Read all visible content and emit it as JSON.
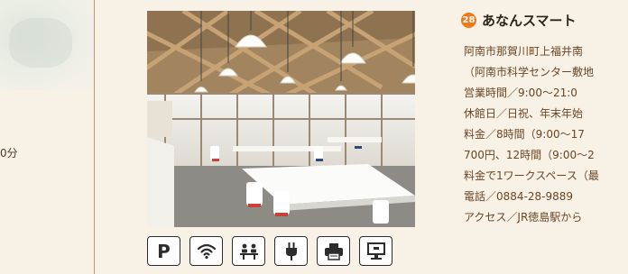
{
  "left": {
    "fragment_text": "0分"
  },
  "listing": {
    "number": "28",
    "title": "あなんスマート",
    "details": [
      "阿南市那賀川町上福井南",
      "（阿南市科学センター敷地",
      "営業時間／9:00〜21:0",
      "休館日／日祝、年末年始",
      "料金／8時間（9:00〜17",
      "700円、12時間（9:00〜2",
      "料金で1ワークスペース（最",
      "電話／0884-28-9889",
      "アクセス／JR徳島駅から"
    ]
  },
  "amenity_icons": [
    "parking-icon",
    "wifi-icon",
    "meeting-room-icon",
    "power-outlet-icon",
    "printer-icon",
    "monitor-icon"
  ],
  "colors": {
    "accent": "#f07a1a",
    "text_brown": "#6b4522",
    "title_dark": "#2e2418",
    "background": "#f7f1e6"
  }
}
